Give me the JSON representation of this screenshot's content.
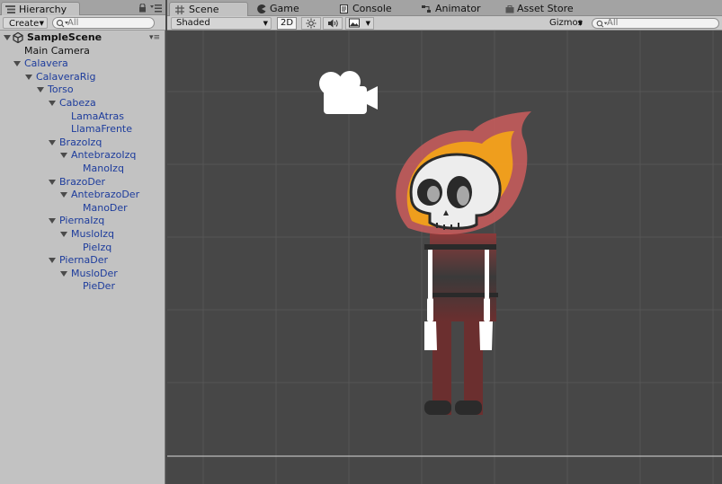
{
  "hierarchy": {
    "tab_label": "Hierarchy",
    "create_label": "Create",
    "search_placeholder": "All",
    "tree": [
      {
        "label": "SampleScene",
        "depth": 0,
        "expanded": true,
        "style": "scene"
      },
      {
        "label": "Main Camera",
        "depth": 1,
        "expanded": null,
        "style": "black"
      },
      {
        "label": "Calavera",
        "depth": 1,
        "expanded": true,
        "style": "blue"
      },
      {
        "label": "CalaveraRig",
        "depth": 2,
        "expanded": true,
        "style": "blue"
      },
      {
        "label": "Torso",
        "depth": 3,
        "expanded": true,
        "style": "blue"
      },
      {
        "label": "Cabeza",
        "depth": 4,
        "expanded": true,
        "style": "blue"
      },
      {
        "label": "LamaAtras",
        "depth": 5,
        "expanded": null,
        "style": "blue"
      },
      {
        "label": "LlamaFrente",
        "depth": 5,
        "expanded": null,
        "style": "blue"
      },
      {
        "label": "BrazoIzq",
        "depth": 4,
        "expanded": true,
        "style": "blue"
      },
      {
        "label": "AntebrazoIzq",
        "depth": 5,
        "expanded": true,
        "style": "blue"
      },
      {
        "label": "ManoIzq",
        "depth": 6,
        "expanded": null,
        "style": "blue"
      },
      {
        "label": "BrazoDer",
        "depth": 4,
        "expanded": true,
        "style": "blue"
      },
      {
        "label": "AntebrazoDer",
        "depth": 5,
        "expanded": true,
        "style": "blue"
      },
      {
        "label": "ManoDer",
        "depth": 6,
        "expanded": null,
        "style": "blue"
      },
      {
        "label": "PiernaIzq",
        "depth": 4,
        "expanded": true,
        "style": "blue"
      },
      {
        "label": "MusloIzq",
        "depth": 5,
        "expanded": true,
        "style": "blue"
      },
      {
        "label": "PieIzq",
        "depth": 6,
        "expanded": null,
        "style": "blue"
      },
      {
        "label": "PiernaDer",
        "depth": 4,
        "expanded": true,
        "style": "blue"
      },
      {
        "label": "MusloDer",
        "depth": 5,
        "expanded": true,
        "style": "blue"
      },
      {
        "label": "PieDer",
        "depth": 6,
        "expanded": null,
        "style": "blue"
      }
    ]
  },
  "tabs": {
    "scene": "Scene",
    "game": "Game",
    "console": "Console",
    "animator": "Animator",
    "asset_store": "Asset Store"
  },
  "scene_toolbar": {
    "shading_mode": "Shaded",
    "mode_2d": "2D",
    "gizmos": "Gizmos",
    "search_placeholder": "All"
  },
  "icons": {
    "hierarchy": "list-icon",
    "scene": "grid-icon",
    "game": "pacman-icon",
    "console": "console-icon",
    "animator": "animator-icon",
    "asset_store": "store-icon",
    "light": "sun-icon",
    "audio": "speaker-icon",
    "effects": "image-icon",
    "camera": "camera-gizmo-icon"
  },
  "colors": {
    "tree_object": "#1d3c9c",
    "viewport_bg": "#474747",
    "flame_outer": "#d35e5e",
    "flame_inner": "#f1a21a",
    "body": "#6b2f2f"
  }
}
